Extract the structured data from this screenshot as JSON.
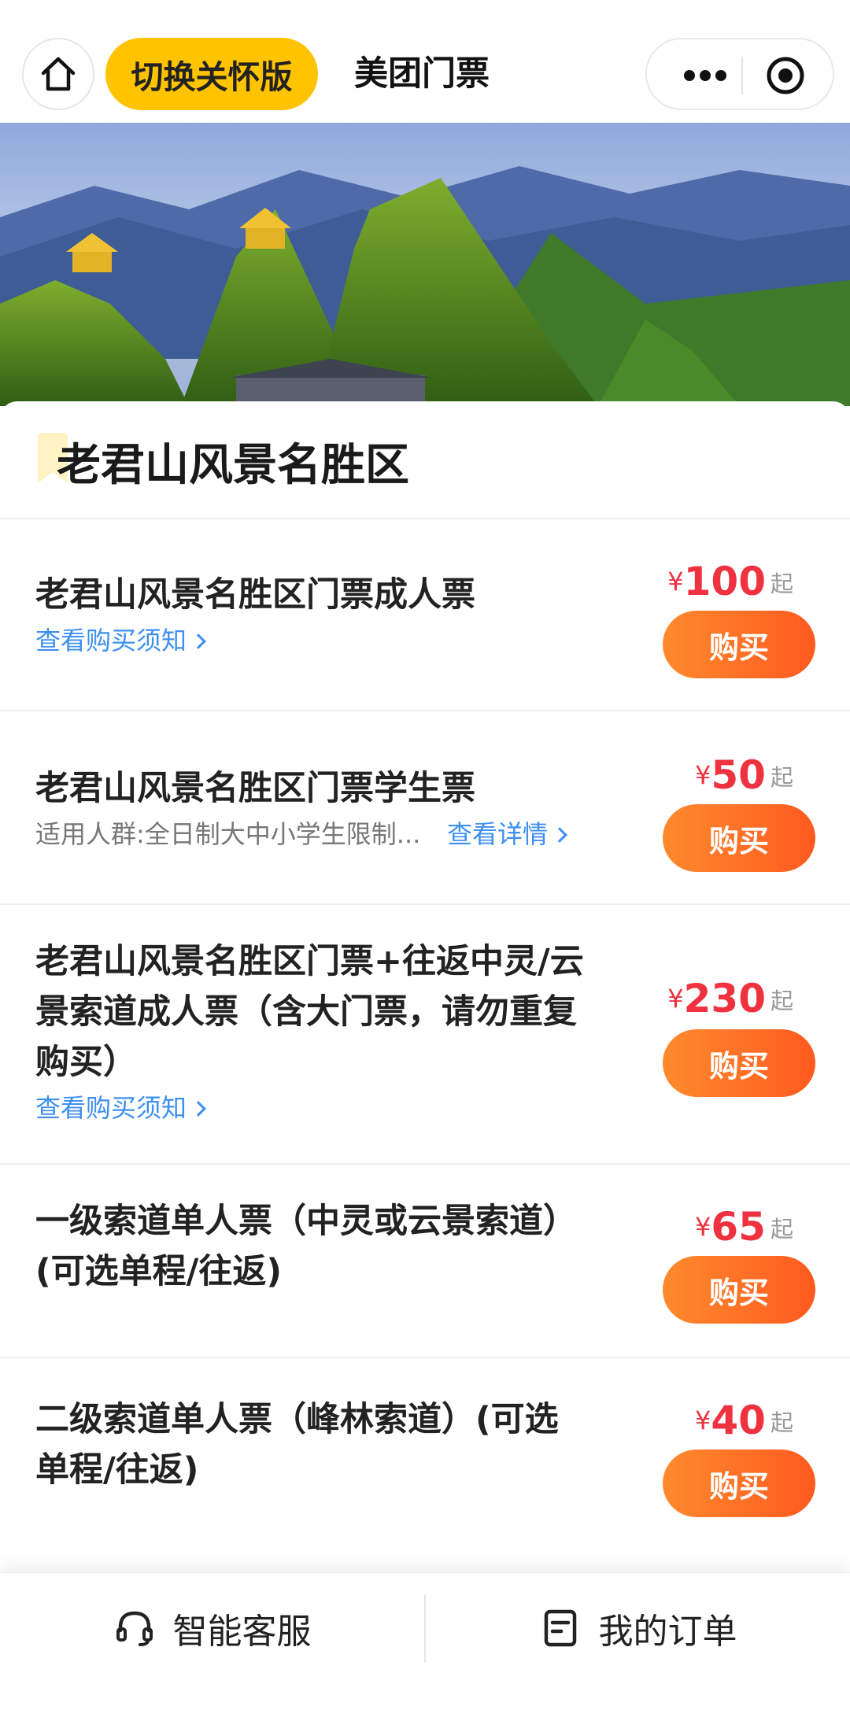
{
  "nav": {
    "care_button": "切换关怀版",
    "title": "美团门票",
    "icons": [
      "home-icon",
      "more-icon",
      "target-icon"
    ]
  },
  "scenic": {
    "name": "老君山风景名胜区"
  },
  "tickets": [
    {
      "name": "老君山风景名胜区门票成人票",
      "link": "查看购买须知",
      "currency": "¥",
      "price": "100",
      "suffix": "起",
      "buy": "购买"
    },
    {
      "name": "老君山风景名胜区门票学生票",
      "desc": "适用人群:全日制大中小学生限制...",
      "link": "查看详情",
      "currency": "¥",
      "price": "50",
      "suffix": "起",
      "buy": "购买"
    },
    {
      "name_lines": [
        "老君山风景名胜区门票+往返中灵/云",
        "景索道成人票（含大门票，请勿重复",
        "购买）"
      ],
      "link": "查看购买须知",
      "currency": "¥",
      "price": "230",
      "suffix": "起",
      "buy": "购买"
    },
    {
      "name_lines": [
        "一级索道单人票（中灵或云景索道）",
        "(可选单程/往返)"
      ],
      "currency": "¥",
      "price": "65",
      "suffix": "起",
      "buy": "购买"
    },
    {
      "name_lines": [
        "二级索道单人票（峰林索道）(可选",
        "单程/往返)"
      ],
      "currency": "¥",
      "price": "40",
      "suffix": "起",
      "buy": "购买"
    }
  ],
  "bottom_bar": {
    "service": "智能客服",
    "orders": "我的订单"
  },
  "colors": {
    "accent_yellow": "#ffc300",
    "price_red": "#f0313f",
    "buy_orange": "#ff6a24",
    "link_blue": "#3d8ff0"
  }
}
